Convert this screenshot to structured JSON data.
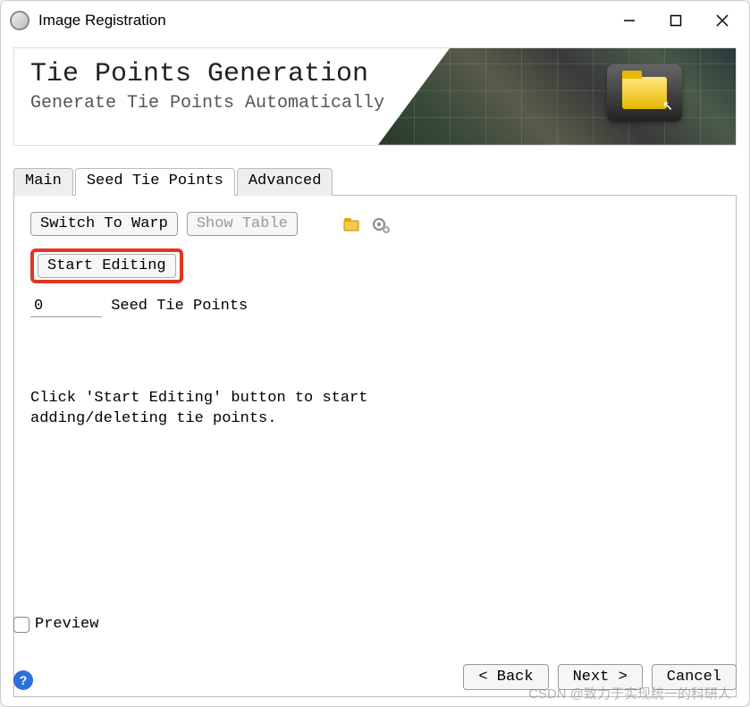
{
  "window": {
    "title": "Image Registration"
  },
  "banner": {
    "title": "Tie Points Generation",
    "subtitle": "Generate Tie Points Automatically"
  },
  "tabs": {
    "items": [
      {
        "label": "Main",
        "active": false
      },
      {
        "label": "Seed Tie Points",
        "active": true
      },
      {
        "label": "Advanced",
        "active": false
      }
    ]
  },
  "toolbar": {
    "switch_label": "Switch To Warp",
    "show_table_label": "Show Table",
    "start_editing_label": "Start Editing"
  },
  "seed": {
    "count_value": "0",
    "count_label": "Seed Tie Points",
    "hint": "Click 'Start Editing' button to start\nadding/deleting tie points."
  },
  "footer": {
    "preview_label": "Preview",
    "back_label": "< Back",
    "next_label": "Next >",
    "cancel_label": "Cancel"
  },
  "watermark": "CSDN @致力于实现统一的科研人"
}
